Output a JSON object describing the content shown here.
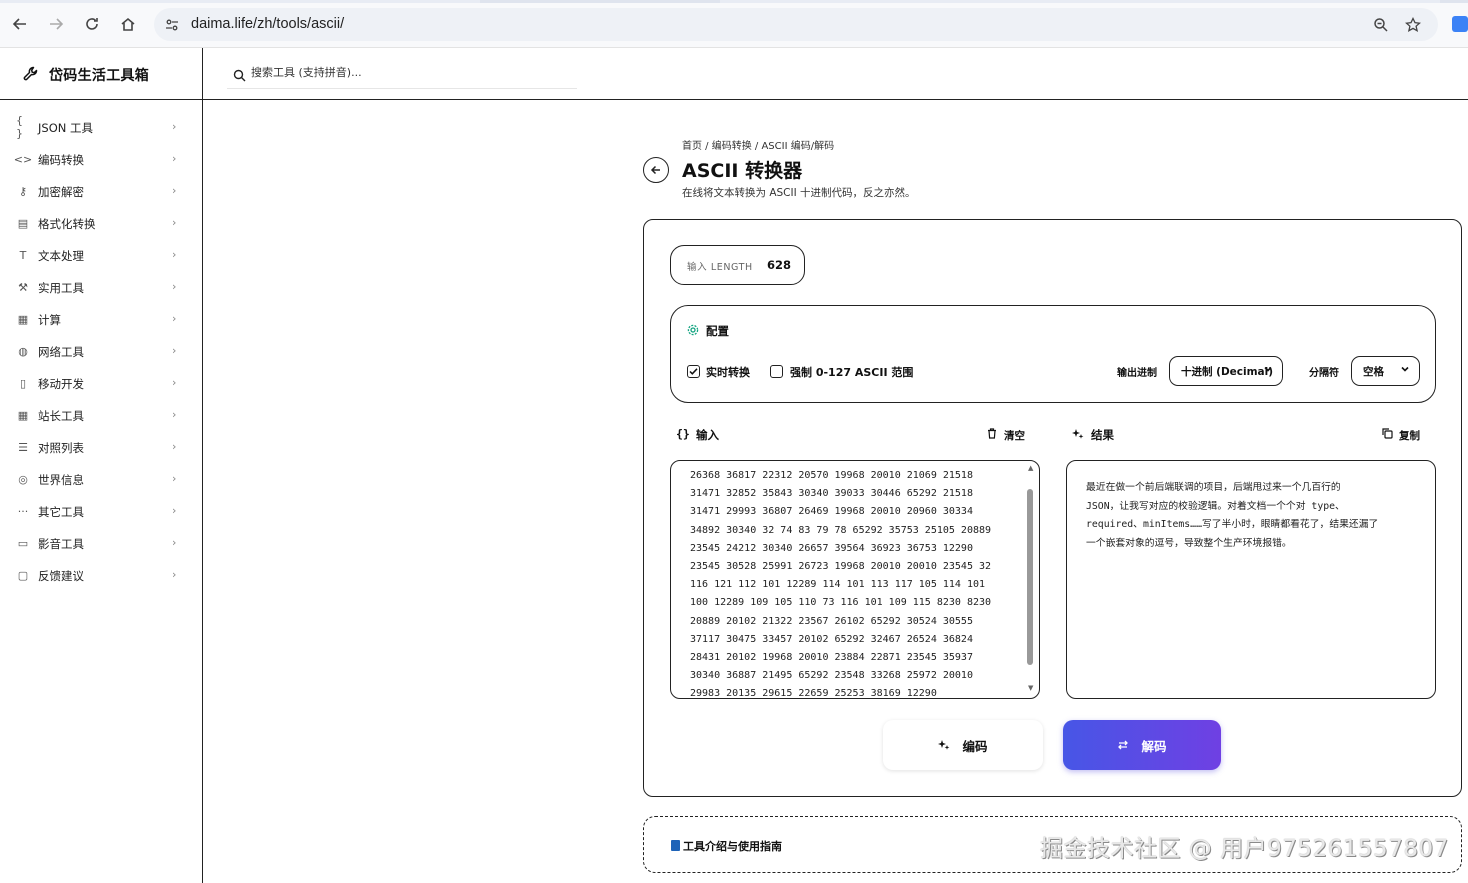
{
  "browser": {
    "url": "daima.life/zh/tools/ascii/"
  },
  "app": {
    "brand": "岱码生活工具箱",
    "search_placeholder": "搜索工具 (支持拼音)..."
  },
  "sidebar": {
    "items": [
      {
        "icon": "braces-icon",
        "label": "JSON 工具"
      },
      {
        "icon": "code-icon",
        "label": "编码转换"
      },
      {
        "icon": "key-icon",
        "label": "加密解密"
      },
      {
        "icon": "file-icon",
        "label": "格式化转换"
      },
      {
        "icon": "text-icon",
        "label": "文本处理"
      },
      {
        "icon": "wrench-icon",
        "label": "实用工具"
      },
      {
        "icon": "calculator-icon",
        "label": "计算"
      },
      {
        "icon": "globe-icon",
        "label": "网络工具"
      },
      {
        "icon": "phone-icon",
        "label": "移动开发"
      },
      {
        "icon": "grid-icon",
        "label": "站长工具"
      },
      {
        "icon": "list-icon",
        "label": "对照列表"
      },
      {
        "icon": "compass-icon",
        "label": "世界信息"
      },
      {
        "icon": "more-icon",
        "label": "其它工具"
      },
      {
        "icon": "video-icon",
        "label": "影音工具"
      },
      {
        "icon": "feedback-icon",
        "label": "反馈建议"
      }
    ]
  },
  "page": {
    "breadcrumb": "首页 / 编码转换 / ASCII 编码/解码",
    "title": "ASCII 转换器",
    "description": "在线将文本转换为 ASCII 十进制代码，反之亦然。"
  },
  "stats": {
    "length_label": "输入 LENGTH",
    "length_value": "628"
  },
  "config": {
    "title": "配置",
    "realtime_label": "实时转换",
    "realtime_checked": true,
    "force_label": "强制 0-127 ASCII 范围",
    "force_checked": false,
    "output_base_label": "输出进制",
    "output_base_value": "十进制 (Decimal)",
    "separator_label": "分隔符",
    "separator_value": "空格"
  },
  "input": {
    "header": "输入",
    "clear_label": "清空",
    "value": "26368 36817 22312 20570 19968 20010 21069 21518\n31471 32852 35843 30340 39033 30446 65292 21518\n31471 29993 36807 26469 19968 20010 20960 30334\n34892 30340 32 74 83 79 78 65292 35753 25105 20889\n23545 24212 30340 26657 39564 36923 36753 12290\n23545 30528 25991 26723 19968 20010 20010 23545 32\n116 121 112 101 12289 114 101 113 117 105 114 101\n100 12289 109 105 110 73 116 101 109 115 8230 8230\n20889 20102 21322 23567 26102 65292 30524 30555\n37117 30475 33457 20102 65292 32467 26524 36824\n28431 20102 19968 20010 23884 22871 23545 35937\n30340 36887 21495 65292 23548 33268 25972 20010\n29983 20135 29615 22659 25253 38169 12290"
  },
  "result": {
    "header": "结果",
    "copy_label": "复制",
    "value": "最近在做一个前后端联调的项目，后端甩过来一个几百行的\nJSON，让我写对应的校验逻辑。对着文档一个个对 type、\nrequired、minItems……写了半小时，眼睛都看花了，结果还漏了\n一个嵌套对象的逗号，导致整个生产环境报错。"
  },
  "actions": {
    "encode_label": "编码",
    "decode_label": "解码"
  },
  "guide": {
    "label": "工具介绍与使用指南"
  },
  "watermark": "掘金技术社区 @ 用户975261557807",
  "colors": {
    "accent_start": "#4756e6",
    "accent_end": "#6f40e3",
    "config_icon": "#10a37f"
  }
}
